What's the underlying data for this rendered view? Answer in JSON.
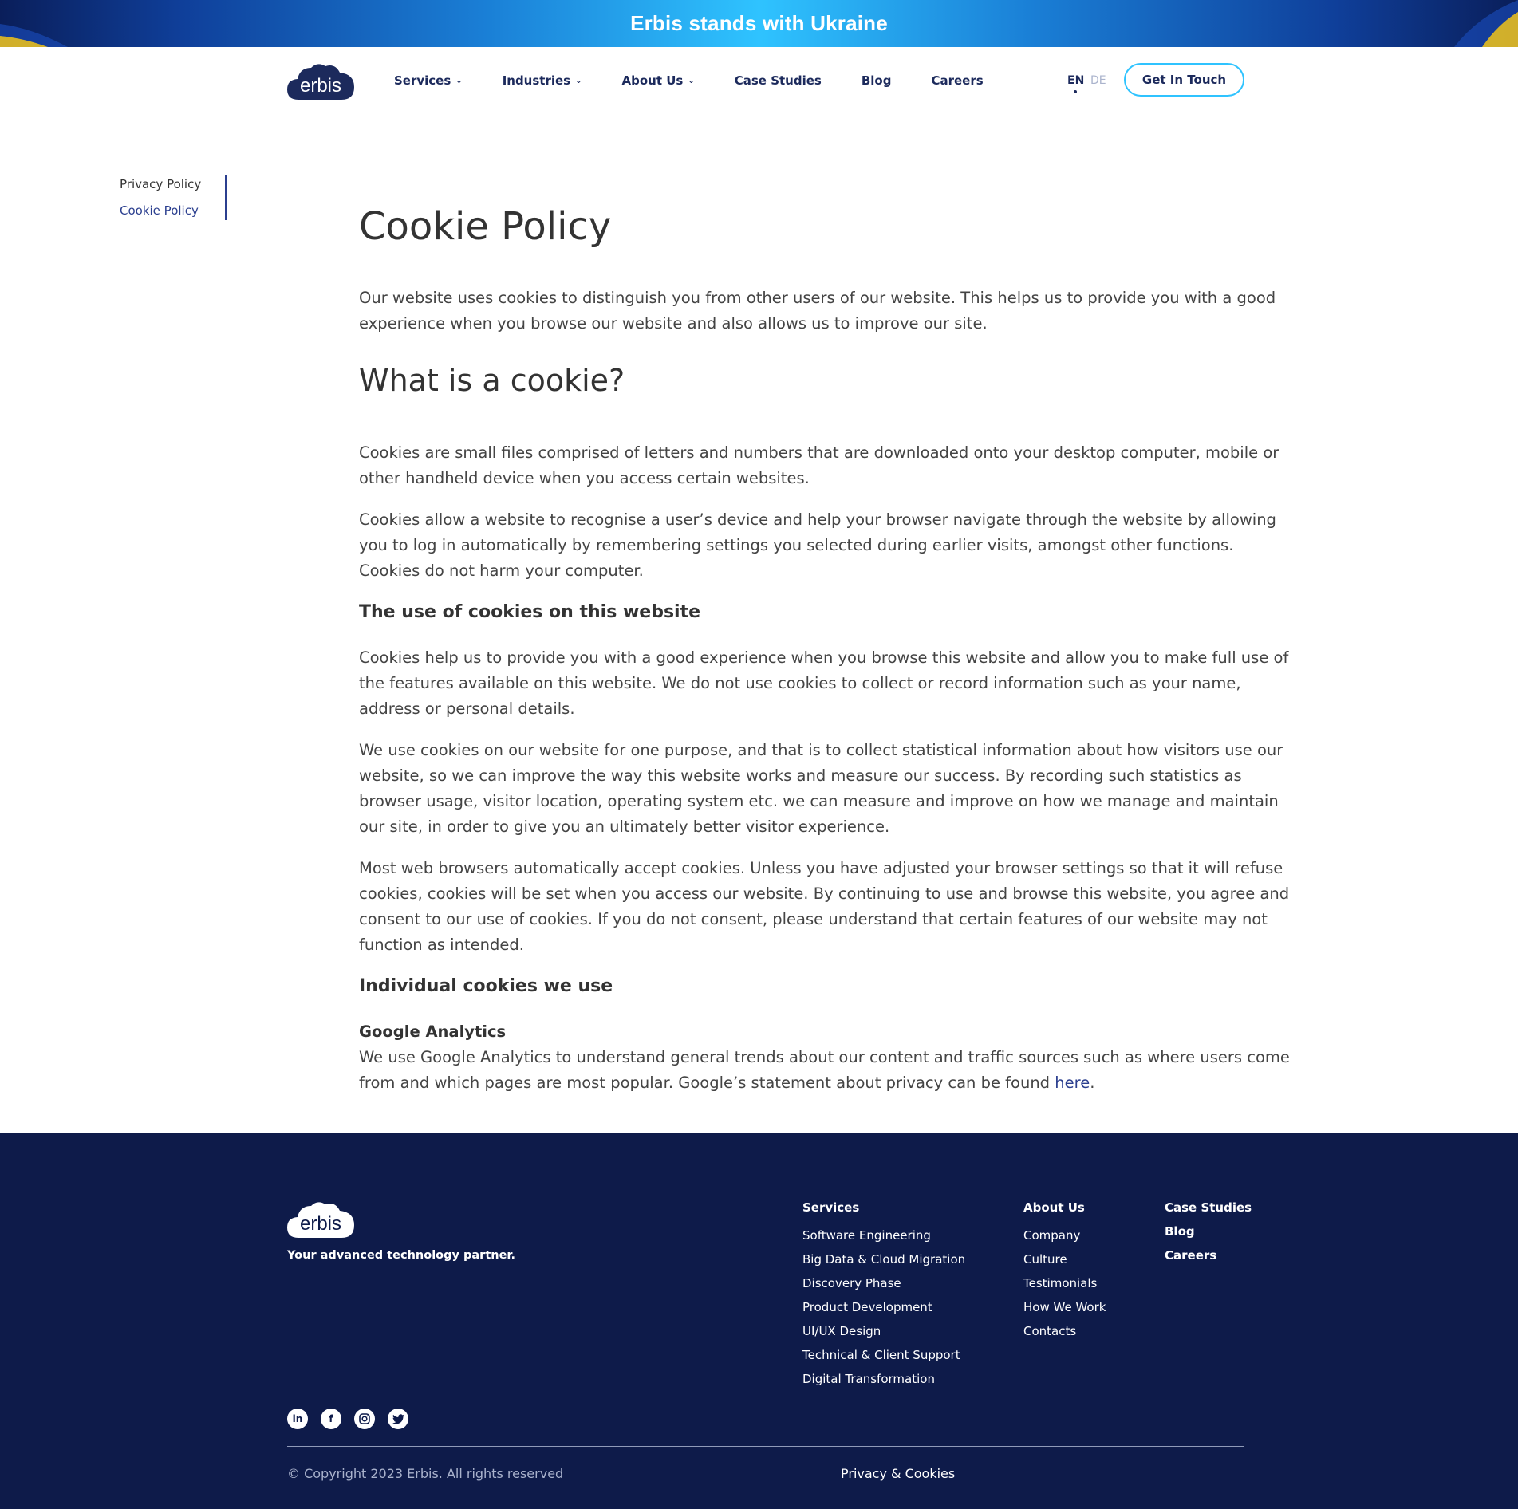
{
  "banner": {
    "text": "Erbis stands with Ukraine"
  },
  "header": {
    "logo_text": "erbis",
    "nav": [
      {
        "label": "Services",
        "has_dropdown": true
      },
      {
        "label": "Industries",
        "has_dropdown": true
      },
      {
        "label": "About Us",
        "has_dropdown": true
      },
      {
        "label": "Case Studies",
        "has_dropdown": false
      },
      {
        "label": "Blog",
        "has_dropdown": false
      },
      {
        "label": "Careers",
        "has_dropdown": false
      }
    ],
    "lang_en": "EN",
    "lang_de": "DE",
    "cta_label": "Get In Touch"
  },
  "sidebar": {
    "items": [
      {
        "label": "Privacy Policy",
        "active": false
      },
      {
        "label": "Cookie Policy",
        "active": true
      }
    ]
  },
  "content": {
    "title": "Cookie Policy",
    "intro": "Our website uses cookies to distinguish you from other users of our website. This helps us to provide you with a good experience when you browse our website and also allows us to improve our site.",
    "what_heading": "What is a cookie?",
    "what_p1": "Cookies are small files comprised of letters and numbers that are downloaded onto your desktop computer, mobile or other handheld device when you access certain websites.",
    "what_p2": "Cookies allow a website to recognise a user’s device and help your browser navigate through the website by allowing you to log in automatically by remembering settings you selected during earlier visits, amongst other functions. Cookies do not harm your computer.",
    "use_heading": "The use of cookies on this website",
    "use_p1": "Cookies help us to provide you with a good experience when you browse this website and allow you to make full use of the features available on this website. We do not use cookies to collect or record information such as your name, address or personal details.",
    "use_p2": "We use cookies on our website for one purpose, and that is to collect statistical information about how visitors use our website, so we can improve the way this website works and measure our success. By recording such statistics as browser usage, visitor location, operating system etc. we can measure and improve on how we manage and maintain our site, in order to give you an ultimately better visitor experience.",
    "use_p3": "Most web browsers automatically accept cookies. Unless you have adjusted your browser settings so that it will refuse cookies, cookies will be set when you access our website. By continuing to use and browse this website, you agree and consent to our use of cookies. If you do not consent, please understand that certain features of our website may not function as intended.",
    "individual_heading": "Individual cookies we use",
    "ga_heading": "Google Analytics",
    "ga_text": "We use Google Analytics to understand general trends about our content and traffic sources such as where users come from and which pages are most popular. Google’s statement about privacy can be found ",
    "ga_link": "here",
    "ga_end": "."
  },
  "footer": {
    "logo_text": "erbis",
    "tagline": "Your advanced technology partner.",
    "services_heading": "Services",
    "services": [
      "Software Engineering",
      "Big Data & Cloud Migration",
      "Discovery Phase",
      "Product Development",
      "UI/UX Design",
      "Technical & Client Support",
      "Digital Transformation"
    ],
    "about_heading": "About Us",
    "about": [
      "Company",
      "Culture",
      "Testimonials",
      "How We Work",
      "Contacts"
    ],
    "extra_links": [
      "Case Studies",
      "Blog",
      "Careers"
    ],
    "socials": [
      "linkedin-icon",
      "facebook-icon",
      "instagram-icon",
      "twitter-icon"
    ],
    "copyright": "© Copyright 2023 Erbis. All rights reserved",
    "privacy_link": "Privacy & Cookies"
  },
  "colors": {
    "navy": "#0e1b4a",
    "accent": "#2fc3ff",
    "link": "#2b3f8f"
  }
}
